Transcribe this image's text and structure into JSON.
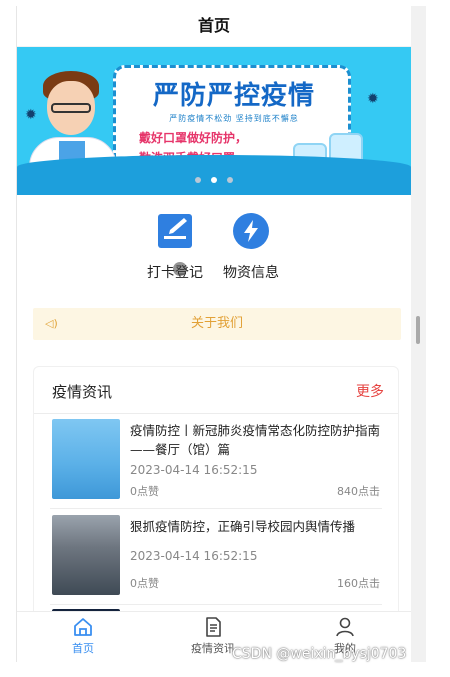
{
  "nav": {
    "title": "首页"
  },
  "banner": {
    "headline": "严防严控疫情",
    "tagline": "严防疫情不松劲 坚持到底不懈怠",
    "line1": "戴好口罩做好防护，",
    "line2": "勤洗双手戴好口罩。",
    "active_slide": 2,
    "slide_count": 3
  },
  "quick_actions": [
    {
      "label": "打卡登记",
      "icon": "checkin-form-icon"
    },
    {
      "label": "物资信息",
      "icon": "lightning-icon"
    }
  ],
  "notice": {
    "label": "关于我们",
    "icon": "speaker-icon"
  },
  "news": {
    "section_title": "疫情资讯",
    "more_label": "更多",
    "items": [
      {
        "title": "疫情防控丨新冠肺炎疫情常态化防控防护指南——餐厅（馆）篇",
        "time": "2023-04-14 16:52:15",
        "likes": "0点赞",
        "clicks": "840点击"
      },
      {
        "title": "狠抓疫情防控，正确引导校园内舆情传播",
        "time": "2023-04-14 16:52:15",
        "likes": "0点赞",
        "clicks": "160点击"
      }
    ]
  },
  "tabbar": {
    "home": "首页",
    "news": "疫情资讯",
    "me": "我的"
  },
  "watermark": "CSDN @weixin_bysj0703",
  "colors": {
    "accent": "#3a8ff0",
    "more": "#e64340",
    "notice_bg": "#fdf6e3",
    "notice_text": "#e2a137",
    "banner_bg": "#35c9f3"
  }
}
